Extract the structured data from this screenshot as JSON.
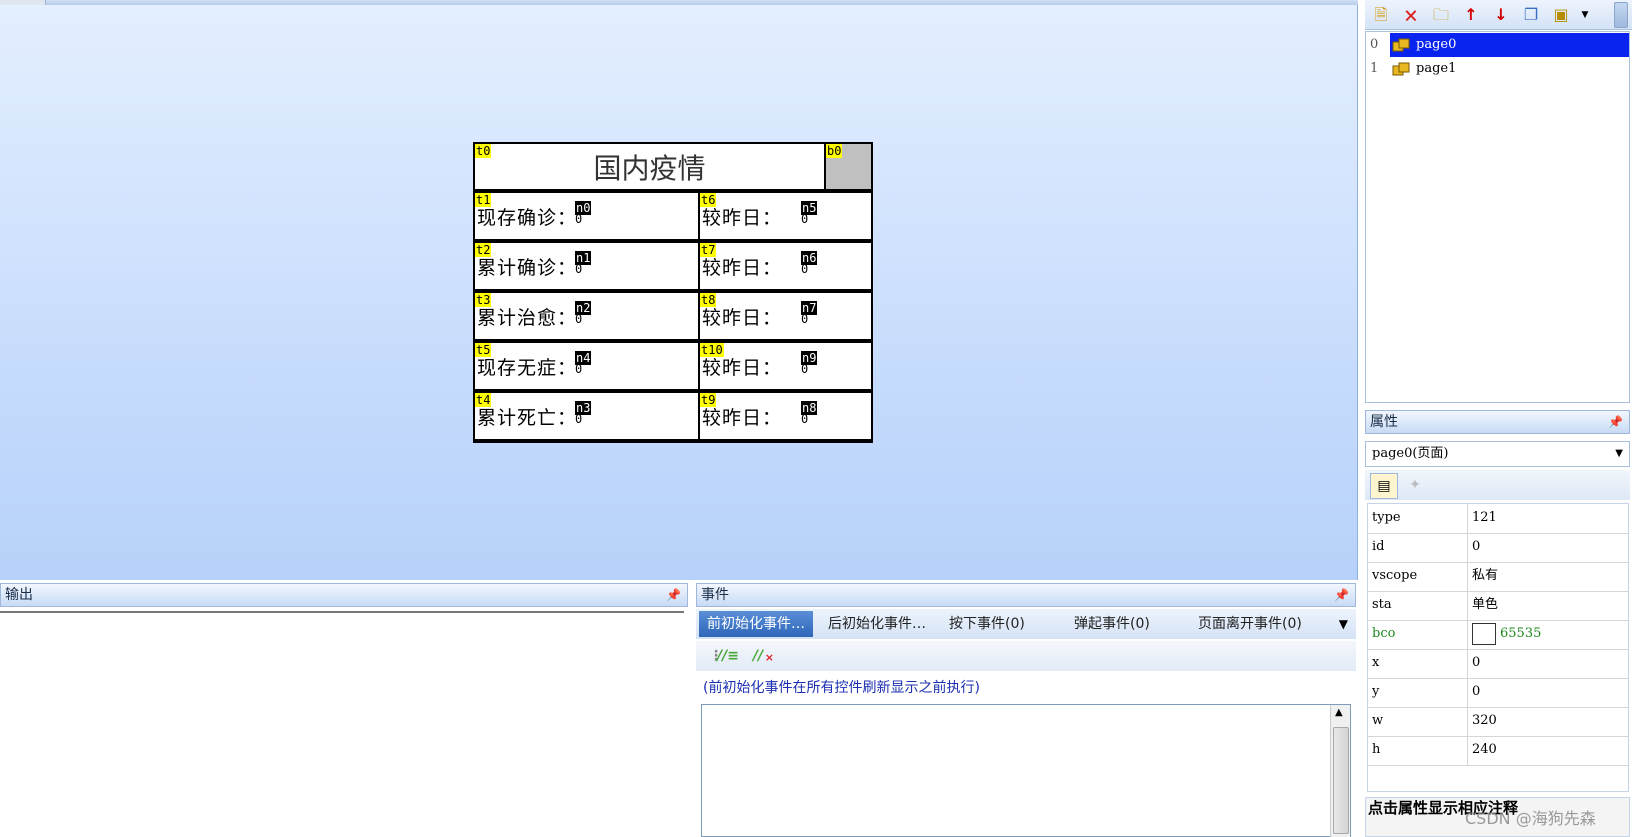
{
  "hmi_page": {
    "title_tag": "t0",
    "title": "国内疫情",
    "button_tag": "b0",
    "rows": [
      {
        "left_tag": "t1",
        "left_label": "现存确诊：",
        "left_num_tag": "n0",
        "left_num": "0",
        "right_tag": "t6",
        "right_label": "较昨日：",
        "right_num_tag": "n5",
        "right_num": "0"
      },
      {
        "left_tag": "t2",
        "left_label": "累计确诊：",
        "left_num_tag": "n1",
        "left_num": "0",
        "right_tag": "t7",
        "right_label": "较昨日：",
        "right_num_tag": "n6",
        "right_num": "0"
      },
      {
        "left_tag": "t3",
        "left_label": "累计治愈：",
        "left_num_tag": "n2",
        "left_num": "0",
        "right_tag": "t8",
        "right_label": "较昨日：",
        "right_num_tag": "n7",
        "right_num": "0"
      },
      {
        "left_tag": "t5",
        "left_label": "现存无症：",
        "left_num_tag": "n4",
        "left_num": "0",
        "right_tag": "t10",
        "right_label": "较昨日：",
        "right_num_tag": "n9",
        "right_num": "0"
      },
      {
        "left_tag": "t4",
        "left_label": "累计死亡：",
        "left_num_tag": "n3",
        "left_num": "0",
        "right_tag": "t9",
        "right_label": "较昨日：",
        "right_num_tag": "n8",
        "right_num": "0"
      }
    ]
  },
  "page_list": {
    "items": [
      {
        "index": "0",
        "name": "page0",
        "selected": true
      },
      {
        "index": "1",
        "name": "page1",
        "selected": false
      }
    ]
  },
  "toolbar": {
    "icons": [
      "add-page-icon",
      "delete-page-icon",
      "import-page-icon",
      "move-up-icon",
      "move-down-icon",
      "copy-page-icon",
      "paste-page-icon",
      "dropdown-icon"
    ]
  },
  "properties": {
    "header": "属性",
    "pin": "ㅁ",
    "selected_object": "page0(页面)",
    "rows": [
      {
        "key": "type",
        "value": "121"
      },
      {
        "key": "id",
        "value": "0"
      },
      {
        "key": "vscope",
        "value": "私有"
      },
      {
        "key": "sta",
        "value": "单色"
      },
      {
        "key": "bco",
        "value": "65535",
        "swatch": "#ffffff"
      },
      {
        "key": "x",
        "value": "0"
      },
      {
        "key": "y",
        "value": "0"
      },
      {
        "key": "w",
        "value": "320"
      },
      {
        "key": "h",
        "value": "240"
      }
    ],
    "hint": "点击属性显示相应注释"
  },
  "output": {
    "header": "输出"
  },
  "events": {
    "header": "事件",
    "tabs": [
      {
        "label": "前初始化事件…",
        "active": true
      },
      {
        "label": "后初始化事件…",
        "active": false
      },
      {
        "label": "按下事件(0)",
        "active": false
      },
      {
        "label": "弹起事件(0)",
        "active": false
      },
      {
        "label": "页面离开事件(0)",
        "active": false
      }
    ],
    "note": "(前初始化事件在所有控件刷新显示之前执行)"
  },
  "watermark": "CSDN @海狗先森",
  "colors": {
    "selection": "#0a24f0",
    "tag_yellow": "#ffff00",
    "active_tab": "#2e66bb"
  }
}
